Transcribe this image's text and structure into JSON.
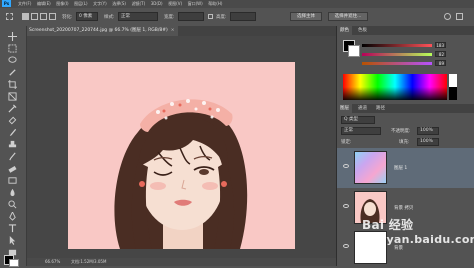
{
  "menubar": {
    "app_logo": "Ps",
    "items": [
      "文件(F)",
      "编辑(E)",
      "图像(I)",
      "图层(L)",
      "文字(Y)",
      "选择(S)",
      "滤镜(T)",
      "3D(D)",
      "视图(V)",
      "窗口(W)",
      "帮助(H)"
    ]
  },
  "options_bar": {
    "mode_label": "选框",
    "feather_label": "羽化:",
    "feather_value": "0 像素",
    "style_label": "样式:",
    "style_value": "正常",
    "width_label": "宽度:",
    "height_label": "高度:",
    "select_subject": "选择主体",
    "select_and_mask": "选择并遮住..."
  },
  "document_tab": {
    "title": "Screenshot_20200707_220744.jpg @ 66.7% (图层 1, RGB/8#)",
    "close": "×"
  },
  "status_bar": {
    "zoom": "66.67%",
    "doc_info": "文档:1.52M/3.05M"
  },
  "color_panel": {
    "tabs": [
      "颜色",
      "色板"
    ],
    "active_tab": "颜色",
    "values": [
      "183",
      "82",
      "89"
    ]
  },
  "layers_panel": {
    "tabs": [
      "图层",
      "通道",
      "路径"
    ],
    "active_tab": "图层",
    "kind_filter": "Q 类型",
    "blend_mode": "正常",
    "opacity_label": "不透明度:",
    "opacity_value": "100%",
    "lock_label": "锁定:",
    "fill_label": "填充:",
    "fill_value": "100%",
    "layers": [
      {
        "name": "图层 1",
        "selected": true
      },
      {
        "name": "背景 拷贝",
        "selected": false
      },
      {
        "name": "背景",
        "selected": false
      }
    ]
  },
  "watermark": {
    "brand": "Bai 经验",
    "url": "jingyan.baidu.com"
  },
  "colors": {
    "canvas_bg": "#f9c8c5",
    "panel_bg": "#535353",
    "workspace_bg": "#464646",
    "selected_layer": "#5f6b78",
    "foreground_color": "#000000",
    "background_color": "#ffffff"
  }
}
